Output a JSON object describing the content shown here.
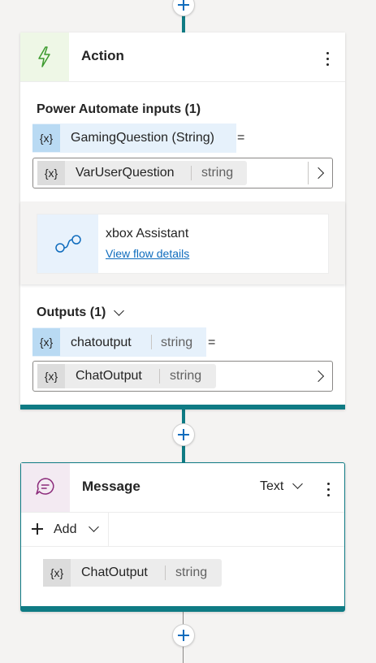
{
  "colors": {
    "accent": "#0f7b84",
    "link": "#0f6cbd",
    "variable_bg": "#cde6f7"
  },
  "action_card": {
    "title": "Action",
    "icon": "lightning-icon",
    "inputs_heading": "Power Automate inputs (1)",
    "input_variable": {
      "badge": "{x}",
      "name": "GamingQuestion (String)",
      "equals": "="
    },
    "input_value": {
      "badge": "{x}",
      "name": "VarUserQuestion",
      "type": "string"
    },
    "flow": {
      "icon": "flow-icon",
      "name": "xbox Assistant",
      "link": "View flow details"
    },
    "outputs_heading": "Outputs (1)",
    "output_variable": {
      "badge": "{x}",
      "name": "chatoutput",
      "type": "string",
      "equals": "="
    },
    "output_value": {
      "badge": "{x}",
      "name": "ChatOutput",
      "type": "string"
    }
  },
  "message_card": {
    "title": "Message",
    "icon": "chat-icon",
    "type_selector": "Text",
    "add_label": "Add",
    "variable": {
      "badge": "{x}",
      "name": "ChatOutput",
      "type": "string"
    }
  }
}
